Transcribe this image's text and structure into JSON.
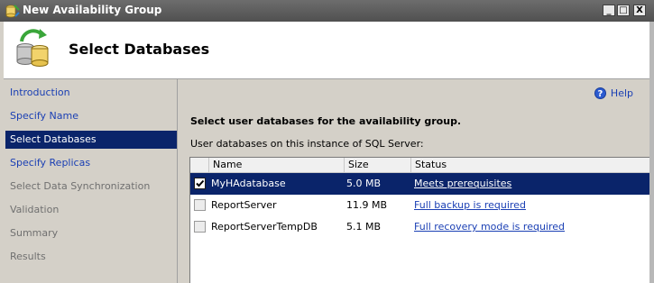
{
  "window": {
    "title": "New Availability Group",
    "controls": {
      "minimize": "_",
      "maximize": "□",
      "close": "X"
    }
  },
  "header": {
    "title": "Select Databases"
  },
  "nav": {
    "items": [
      {
        "label": "Introduction",
        "state": "link"
      },
      {
        "label": "Specify Name",
        "state": "link"
      },
      {
        "label": "Select Databases",
        "state": "selected"
      },
      {
        "label": "Specify Replicas",
        "state": "link"
      },
      {
        "label": "Select Data Synchronization",
        "state": "disabled"
      },
      {
        "label": "Validation",
        "state": "disabled"
      },
      {
        "label": "Summary",
        "state": "disabled"
      },
      {
        "label": "Results",
        "state": "disabled"
      }
    ]
  },
  "main": {
    "help_label": "Help",
    "help_icon_glyph": "?",
    "instruction": "Select user databases for the availability group.",
    "sublabel": "User databases on this instance of SQL Server:",
    "table": {
      "columns": [
        "Name",
        "Size",
        "Status"
      ],
      "rows": [
        {
          "checked": true,
          "name": "MyHAdatabase",
          "size": "5.0 MB",
          "status": "Meets prerequisites",
          "selected": true
        },
        {
          "checked": false,
          "name": "ReportServer",
          "size": "11.9 MB",
          "status": "Full backup is required",
          "selected": false
        },
        {
          "checked": false,
          "name": "ReportServerTempDB",
          "size": "5.1 MB",
          "status": "Full recovery mode is required",
          "selected": false
        }
      ]
    }
  },
  "colors": {
    "selection": "#0a246a",
    "link": "#1a3fb4",
    "disabled_text": "#707070",
    "titlebar": "#505050"
  },
  "icons": {
    "app": "database-wizard-icon",
    "header": "database-sync-icon",
    "checkbox_checked": "checkmark-icon"
  }
}
